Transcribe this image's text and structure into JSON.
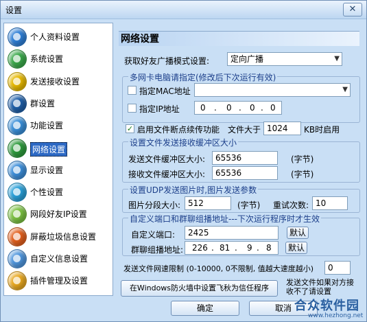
{
  "window": {
    "title": "设置",
    "close_glyph": "✕"
  },
  "sidebar": {
    "items": [
      {
        "label": "个人资料设置",
        "color": "#2f7fd6"
      },
      {
        "label": "系统设置",
        "color": "#3aa84a"
      },
      {
        "label": "发送接收设置",
        "color": "#e6b800"
      },
      {
        "label": "群设置",
        "color": "#1f5fa8"
      },
      {
        "label": "功能设置",
        "color": "#3a8fd8"
      },
      {
        "label": "网络设置",
        "color": "#2e9a3c"
      },
      {
        "label": "显示设置",
        "color": "#3d8ed9"
      },
      {
        "label": "个性设置",
        "color": "#2aa0d8"
      },
      {
        "label": "网段好友IP设置",
        "color": "#7bc142"
      },
      {
        "label": "屏蔽垃圾信息设置",
        "color": "#e2601e"
      },
      {
        "label": "自定义信息设置",
        "color": "#4f95dc"
      },
      {
        "label": "插件管理及设置",
        "color": "#e8a820"
      }
    ],
    "active_index": 5
  },
  "panel": {
    "heading": "网络设置",
    "broadcast_mode_label": "获取好友广播模式设置:",
    "broadcast_mode_value": "定向广播",
    "multi_nic": {
      "title": "多网卡电脑请指定(修改后下次运行有效)",
      "mac_label": "指定MAC地址",
      "mac_value": "",
      "ip_label": "指定IP地址",
      "ip_octets": [
        "0",
        "0",
        "0",
        "0"
      ],
      "ip_sep": "."
    },
    "resume": {
      "label": "启用文件断点续传功能",
      "checked_glyph": "✓",
      "size_label": "文件大于",
      "size_value": "1024",
      "unit_label": "KB时启用"
    },
    "buffer": {
      "title": "设置文件发送接收缓冲区大小",
      "send_label": "发送文件缓冲区大小:",
      "send_value": "65536",
      "send_unit": "(字节)",
      "recv_label": "接收文件缓冲区大小:",
      "recv_value": "65536",
      "recv_unit": "(字节)"
    },
    "udp": {
      "title": "设置UDP发送图片时,图片发送参数",
      "seg_label": "图片分段大小:",
      "seg_value": "512",
      "seg_unit": "(字节)",
      "retry_label": "重试次数:",
      "retry_value": "10"
    },
    "multicast": {
      "title": "自定义端口和群聊组播地址---下次运行程序时才生效",
      "port_label": "自定义端口:",
      "port_value": "2425",
      "port_default": "默认",
      "addr_label": "群聊组播地址:",
      "addr_octets": [
        "226",
        "81",
        "9",
        "8"
      ],
      "addr_sep": ".",
      "addr_default": "默认"
    },
    "speed_label": "发送文件网速限制 (0-10000, 0不限制, 值越大速度越小)",
    "speed_value": "0",
    "firewall_button": "在Windows防火墙中设置飞秋为信任程序",
    "firewall_note": "发送文件如果对方接收不了请设置"
  },
  "footer": {
    "ok": "确定",
    "cancel": "取消"
  },
  "watermark": {
    "text": "合众软件园",
    "url": "www.hezhong.net"
  }
}
